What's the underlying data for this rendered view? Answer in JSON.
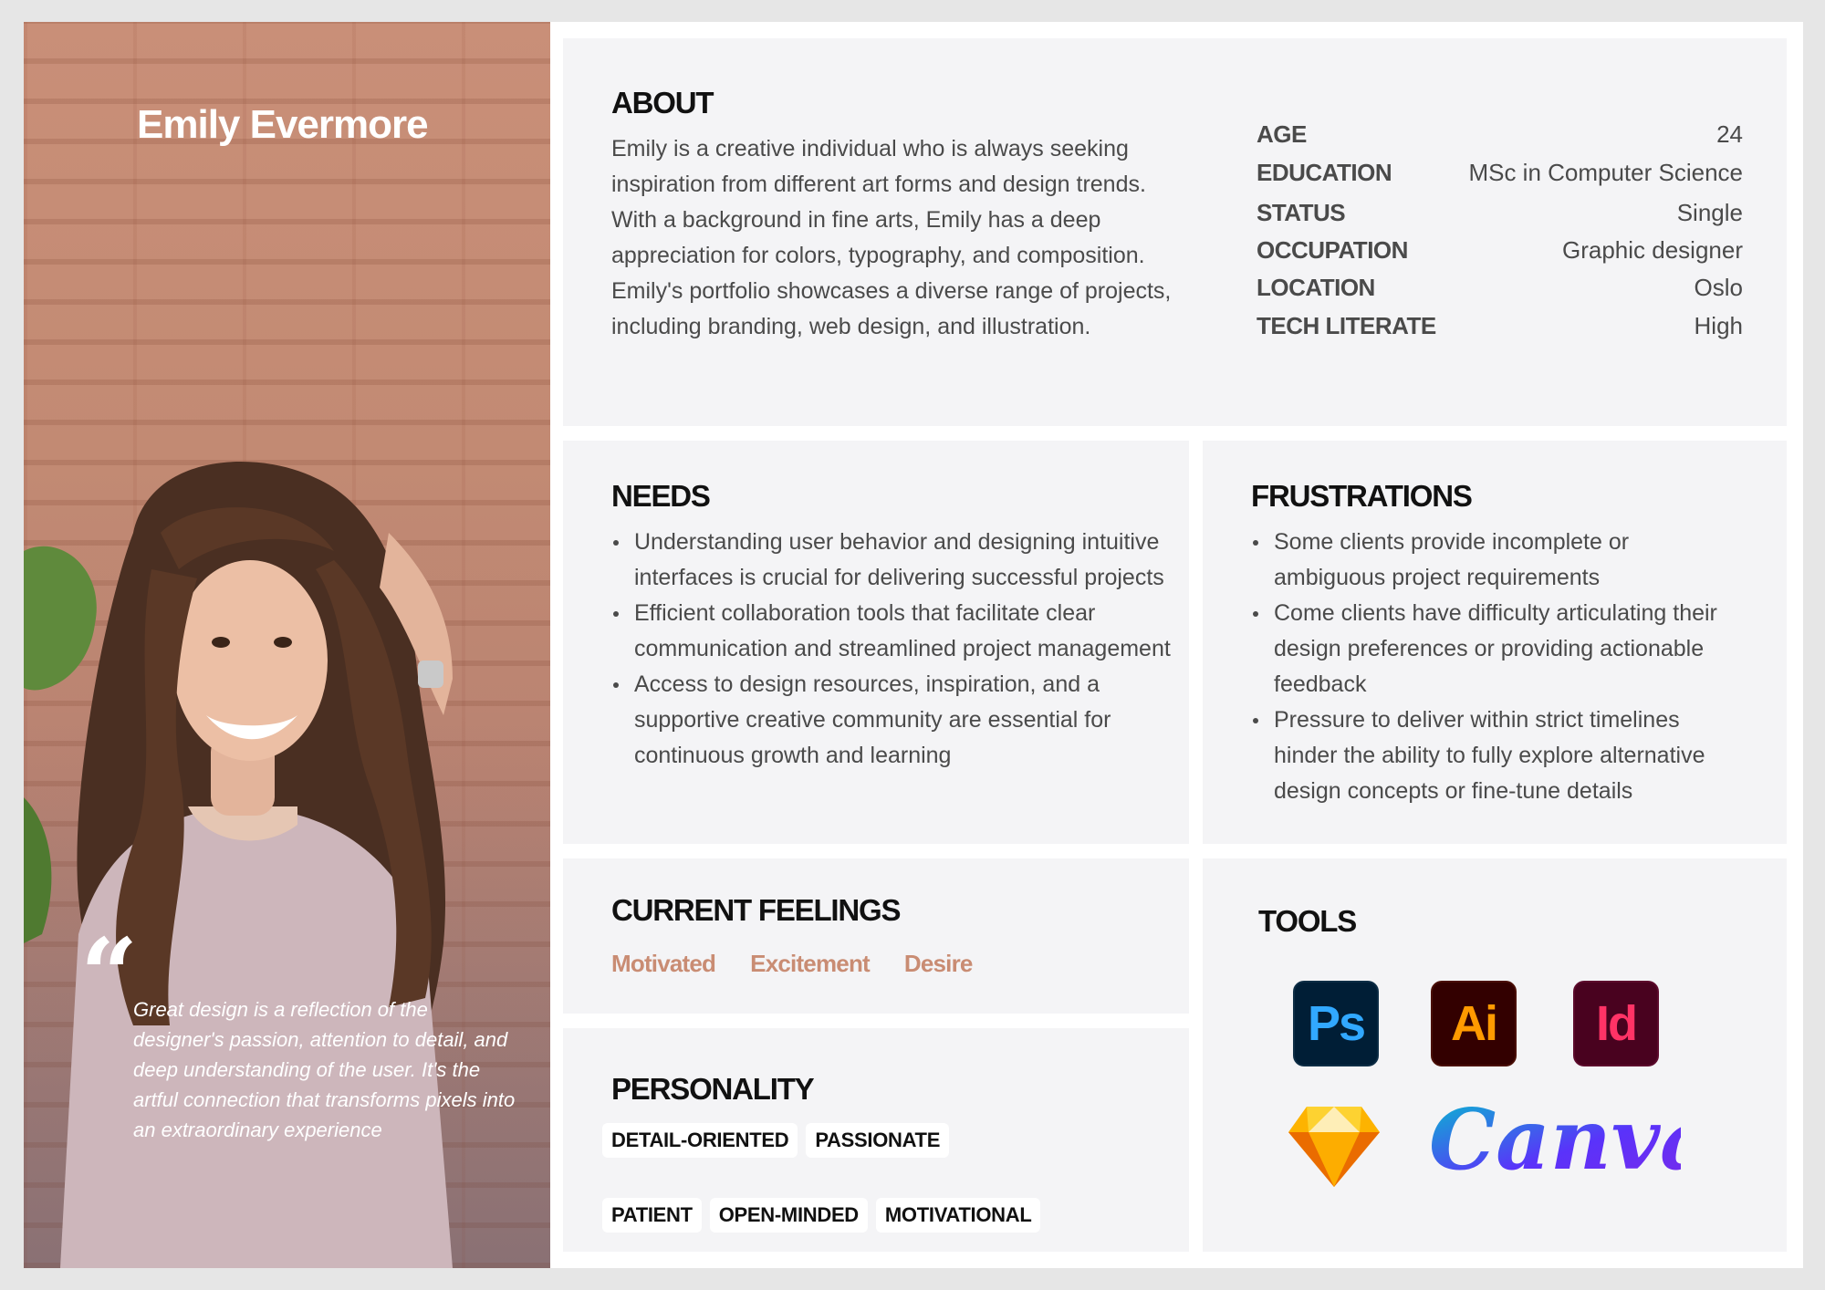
{
  "persona": {
    "name": "Emily Evermore",
    "quote_mark": "“",
    "quote": "Great design is a reflection of the designer's passion, attention to detail, and deep understanding of the user. It's the artful connection that transforms pixels into an extraordinary experience"
  },
  "about": {
    "title": "ABOUT",
    "text": "Emily is a creative individual who is always seeking inspiration from different art forms and design trends. With a background in fine arts, Emily has a deep appreciation for colors, typography, and composition. Emily's portfolio showcases a diverse range of projects, including branding, web design, and illustration.",
    "info": [
      {
        "key": "AGE",
        "value": "24"
      },
      {
        "key": "EDUCATION",
        "value": "MSc in Computer Science"
      },
      {
        "key": "STATUS",
        "value": "Single"
      },
      {
        "key": "OCCUPATION",
        "value": "Graphic designer"
      },
      {
        "key": "LOCATION",
        "value": "Oslo"
      },
      {
        "key": "TECH LITERATE",
        "value": "High"
      }
    ]
  },
  "needs": {
    "title": "NEEDS",
    "items": [
      "Understanding user behavior and designing intuitive interfaces is crucial for delivering successful projects",
      "Efficient collaboration tools that facilitate clear communication and streamlined project management",
      "Access to design resources, inspiration, and a supportive creative community are essential for continuous growth and learning"
    ]
  },
  "frustrations": {
    "title": "FRUSTRATIONS",
    "items": [
      "Some clients provide incomplete or ambiguous project requirements",
      "Come clients have difficulty articulating their design preferences or providing actionable feedback",
      "Pressure to deliver within strict timelines hinder the ability to fully explore alternative design concepts or fine-tune details"
    ]
  },
  "feelings": {
    "title": "CURRENT FEELINGS",
    "items": [
      "Motivated",
      "Excitement",
      "Desire"
    ]
  },
  "personality": {
    "title": "PERSONALITY",
    "traits": [
      "DETAIL-ORIENTED",
      "PASSIONATE",
      "PATIENT",
      "OPEN-MINDED",
      "MOTIVATIONAL"
    ]
  },
  "tools": {
    "title": "TOOLS",
    "ps_label": "Ps",
    "ai_label": "Ai",
    "id_label": "Id",
    "canva_label": "Canva",
    "icons": [
      "photoshop-icon",
      "illustrator-icon",
      "indesign-icon",
      "sketch-icon",
      "canva-logo"
    ]
  },
  "colors": {
    "card_bg": "#f4f4f6",
    "accent": "#c98c73",
    "ps_bg": "#001e36",
    "ps_fg": "#31a8ff",
    "ai_bg": "#330000",
    "ai_fg": "#ff9a00",
    "id_bg": "#49021f",
    "id_fg": "#ff3366"
  }
}
